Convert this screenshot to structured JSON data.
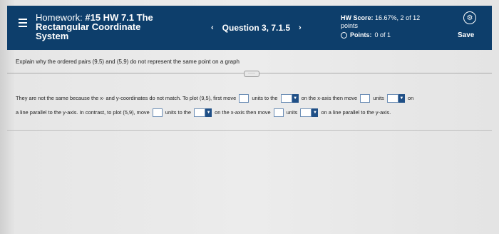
{
  "header": {
    "title_prefix": "Homework:",
    "title_line1": "#15 HW 7.1 The",
    "title_line2": "Rectangular Coordinate",
    "title_line3": "System",
    "question_label": "Question 3, 7.1.5",
    "prev_arrow": "‹",
    "next_arrow": "›",
    "score_label": "HW Score:",
    "score_value": "16.67%, 2 of 12",
    "score_unit": "points",
    "points_label": "Points:",
    "points_value": "0 of 1",
    "save_label": "Save"
  },
  "question": {
    "instruction": "Explain why the ordered pairs (9,5) and (5,9) do not represent the same point on a graph",
    "more_label": "·····"
  },
  "answer": {
    "part1": "They are not the same because the x- and y-coordinates do not match. To plot (9,5), first move",
    "part2": "units to the",
    "part3": "on the x-axis then move",
    "part4": "units",
    "part5": "on",
    "part6": "a line parallel to the y-axis. In contrast, to plot (5,9), move",
    "part7": "units to the",
    "part8": "on the x-axis then move",
    "part9": "units",
    "part10": "on a line parallel to the y-axis."
  },
  "icons": {
    "menu": "menu-icon",
    "gear": "gear-icon",
    "caret": "dropdown-caret-icon"
  },
  "colors": {
    "header_bg": "#0d3e6b",
    "dropdown_caret": "#1f4f86"
  }
}
